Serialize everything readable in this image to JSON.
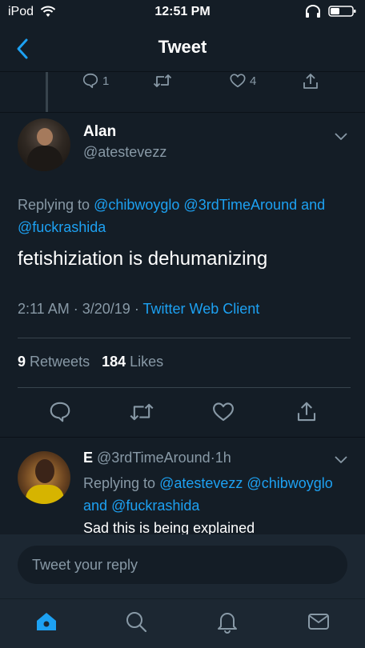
{
  "status_bar": {
    "carrier": "iPod",
    "time": "12:51 PM"
  },
  "nav": {
    "title": "Tweet"
  },
  "previous_tweet_actions": {
    "reply_count": "1",
    "like_count": "4"
  },
  "tweet": {
    "author_name": "Alan",
    "author_handle": "@atestevezz",
    "replying_prefix": "Replying to",
    "replying_mention_1": "@chibwoyglo",
    "replying_mention_2": "@3rdTimeAround",
    "replying_and": "and",
    "replying_mention_3": "@fuckrashida",
    "text": "fetishiziation is dehumanizing",
    "time": "2:11 AM",
    "meta_sep_1": "·",
    "date": "3/20/19",
    "meta_sep_2": "·",
    "client": "Twitter Web Client",
    "retweet_count": "9",
    "retweet_label": "Retweets",
    "like_count": "184",
    "like_label": "Likes"
  },
  "reply": {
    "name": "E",
    "handle": "@3rdTimeAround",
    "dot": "·",
    "age": "1h",
    "replying_prefix": "Replying to",
    "replying_mention_1": "@atestevezz",
    "replying_mention_2": "@chibwoyglo",
    "replying_and": "and",
    "replying_mention_3": "@fuckrashida",
    "text": "Sad this is being explained"
  },
  "composer": {
    "placeholder": "Tweet your reply"
  },
  "tabbar": {
    "items": [
      "home-icon",
      "search-icon",
      "notifications-icon",
      "messages-icon"
    ]
  },
  "colors": {
    "background": "#141d26",
    "accent": "#1da1f2",
    "muted": "#8899a6"
  }
}
